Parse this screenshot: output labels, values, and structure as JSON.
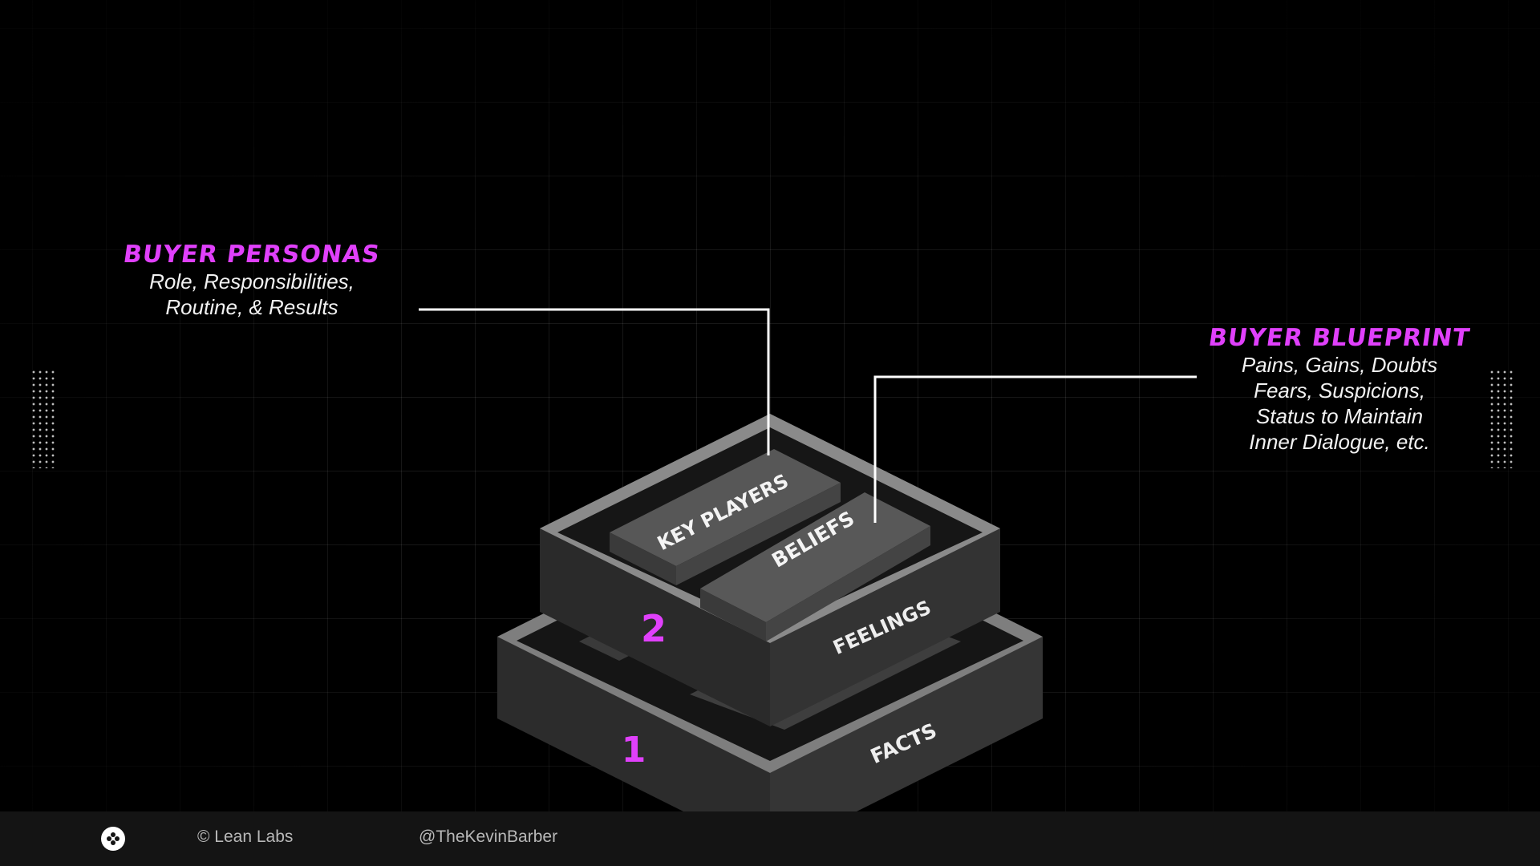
{
  "callouts": {
    "personas": {
      "heading": "BUYER PERSONAS",
      "lines": [
        "Role, Responsibilities,",
        "Routine, & Results"
      ]
    },
    "blueprint": {
      "heading": "BUYER BLUEPRINT",
      "lines": [
        "Pains, Gains, Doubts",
        "Fears, Suspicions,",
        "Status to Maintain",
        "Inner Dialogue, etc."
      ]
    }
  },
  "diagram": {
    "top_layer": {
      "number": "2",
      "side_label": "FEELINGS",
      "blocks": [
        "KEY PLAYERS",
        "BELIEFS"
      ]
    },
    "bottom_layer": {
      "number": "1",
      "side_label": "FACTS"
    }
  },
  "footer": {
    "copyright": "© Lean Labs",
    "handle": "@TheKevinBarber"
  },
  "colors": {
    "accent": "#e040fb",
    "background": "#000000",
    "footer_bg": "#141414"
  },
  "icons": {
    "footer_logo": "lean-labs-logo-icon"
  }
}
